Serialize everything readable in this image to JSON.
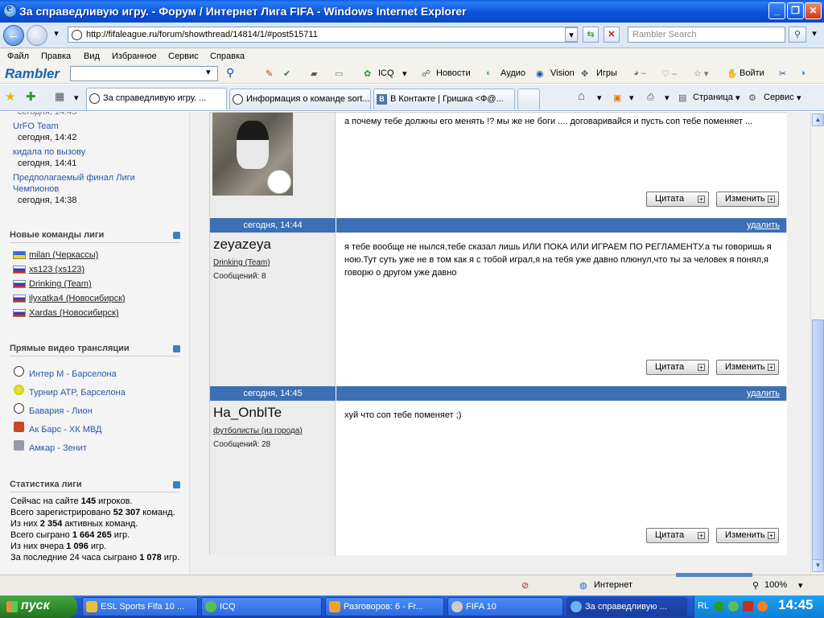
{
  "window": {
    "title": "За справедливую игру. - Форум / Интернет Лига FIFA - Windows Internet Explorer",
    "btn_min": "_",
    "btn_max": "❐",
    "btn_close": "✕"
  },
  "address": {
    "url": "http://fifaleague.ru/forum/showthread/14814/1/#post515711",
    "search_placeholder": "Rambler Search"
  },
  "menu": [
    "Файл",
    "Правка",
    "Вид",
    "Избранное",
    "Сервис",
    "Справка"
  ],
  "rambler": {
    "logo": "Rambler",
    "items": [
      "ICQ",
      "Новости",
      "Аудио",
      "Vision",
      "Игры",
      "Войти"
    ]
  },
  "tabs": [
    {
      "label": "За справедливую игру. ..."
    },
    {
      "label": "Информация о команде sort..."
    },
    {
      "label": "В Контакте | Гришка <Ф@..."
    }
  ],
  "tabtools": {
    "page": "Страница",
    "service": "Сервис"
  },
  "sidebar": {
    "recent": [
      {
        "title": "UrFO Team",
        "time": "сегодня, 14:42"
      },
      {
        "title": "кидала по вызову",
        "time": "сегодня, 14:41"
      },
      {
        "title": "Предполагаемый финал Лиги",
        "title2": "Чемпионов",
        "time": "сегодня, 14:38"
      }
    ],
    "new_teams_title": "Новые команды лиги",
    "new_teams": [
      "milan (Черкассы)",
      "xs123 (xs123)",
      "Drinking (Team)",
      "ilyxatka4 (Новосибирск)",
      "Xardas (Новосибирск)"
    ],
    "video_title": "Прямые видео трансляции",
    "videos": [
      "Интер М - Барселона",
      "Турнир ATP, Барселона",
      "Бавария - Лион",
      "Ак Барс - ХК МВД",
      "Амкар - Зенит"
    ],
    "stats_title": "Статистика лиги",
    "stats": [
      {
        "pre": "Сейчас на сайте ",
        "num": "145",
        "post": " игроков."
      },
      {
        "pre": "Всего зарегистрировано ",
        "num": "52 307",
        "post": " команд."
      },
      {
        "pre": "Из них ",
        "num": "2 354",
        "post": " активных команд."
      },
      {
        "pre": "Всего сыграно ",
        "num": "1 664 265",
        "post": " игр."
      },
      {
        "pre": "Из них вчера ",
        "num": "1 096",
        "post": " игр."
      },
      {
        "pre": "За последние 24 часа сыграно ",
        "num": "1 078",
        "post": " игр."
      }
    ]
  },
  "posts": [
    {
      "text": "а почему тебе должны его менять !? мы же не боги .... договаривайся и пусть соп тебе поменяет ..."
    },
    {
      "date": "сегодня, 14:44",
      "delete": "удалить",
      "user": "zeyazeya",
      "team": "Drinking (Team)",
      "count": "Сообщений: 8",
      "text": "я тебе вообще не нылся,тебе сказал лишь ИЛИ ПОКА ИЛИ ИГРАЕМ ПО РЕГЛАМЕНТУ.а ты говоришь я ною.Тут суть уже не в том как я с тобой играл,я на тебя уже давно плюнул,что ты за человек я понял,я говорю о другом уже давно"
    },
    {
      "date": "сегодня, 14:45",
      "delete": "удалить",
      "user": "Ha_OnblTe",
      "team": "футболисты (из города)",
      "count": "Сообщений: 28",
      "text": "хуй что соп тебе поменяет ;)"
    }
  ],
  "buttons": {
    "quote": "Цитата",
    "edit": "Изменить"
  },
  "status": {
    "zone": "Интернет",
    "zoom": "100%"
  },
  "taskbar": {
    "start": "пуск",
    "tasks": [
      "ESL Sports Fifa 10 ...",
      "ICQ",
      "Разговоров: 6 - Fr...",
      "FIFA 10",
      "За справедливую ..."
    ],
    "lang": "RL",
    "time": "14:45"
  }
}
